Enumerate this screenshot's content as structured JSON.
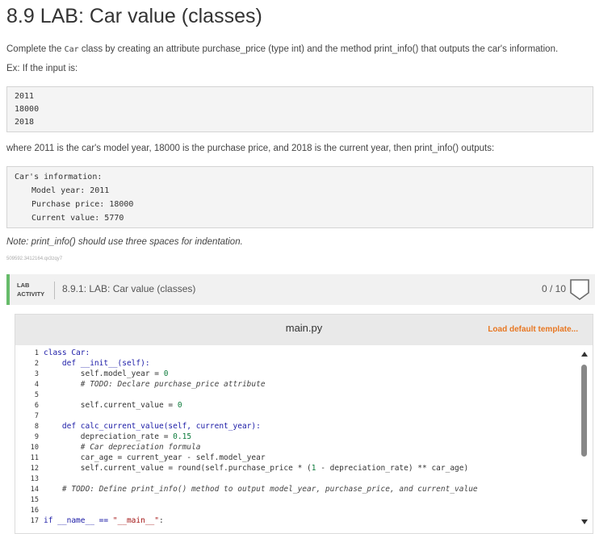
{
  "heading": "8.9 LAB: Car value (classes)",
  "intro": {
    "before": "Complete the ",
    "code": "Car",
    "after": " class by creating an attribute purchase_price (type int) and the method print_info() that outputs the car's information."
  },
  "example_label": "Ex: If the input is:",
  "input_lines": [
    "2011",
    "18000",
    "2018"
  ],
  "explanation": "where 2011 is the car's model year, 18000 is the purchase price, and 2018 is the current year, then print_info() outputs:",
  "output_lines": {
    "header": "Car's information:",
    "l1": "Model year: 2011",
    "l2": "Purchase price: 18000",
    "l3": "Current value: 5770"
  },
  "note": "Note: print_info() should use three spaces for indentation.",
  "tiny_id": "509592.3412164.qx3zqy7",
  "lab": {
    "tag_line1": "LAB",
    "tag_line2": "ACTIVITY",
    "name": "8.9.1: LAB: Car value (classes)",
    "score": "0 / 10",
    "badge_icon": "shield-icon"
  },
  "editor": {
    "file_name": "main.py",
    "load_template": "Load default template...",
    "line_numbers": [
      "1",
      "2",
      "3",
      "4",
      "5",
      "6",
      "7",
      "8",
      "9",
      "10",
      "11",
      "12",
      "13",
      "14",
      "15",
      "16",
      "17"
    ],
    "code": {
      "l1": "class Car:",
      "l2": "    def __init__(self):",
      "l3a": "        self.model_year = ",
      "l3b": "0",
      "l4": "        # TODO: Declare purchase_price attribute",
      "l6a": "        self.current_value = ",
      "l6b": "0",
      "l8": "    def calc_current_value(self, current_year):",
      "l9a": "        depreciation_rate = ",
      "l9b": "0.15",
      "l10": "        # Car depreciation formula",
      "l11": "        car_age = current_year - self.model_year",
      "l12a": "        self.current_value = round(self.purchase_price * (",
      "l12b": "1",
      "l12c": " - depreciation_rate) ** car_age)",
      "l14": "    # TODO: Define print_info() method to output model_year, purchase_price, and current_value",
      "l17a": "if __name__ == ",
      "l17b": "\"__main__\"",
      "l17c": ":"
    }
  }
}
